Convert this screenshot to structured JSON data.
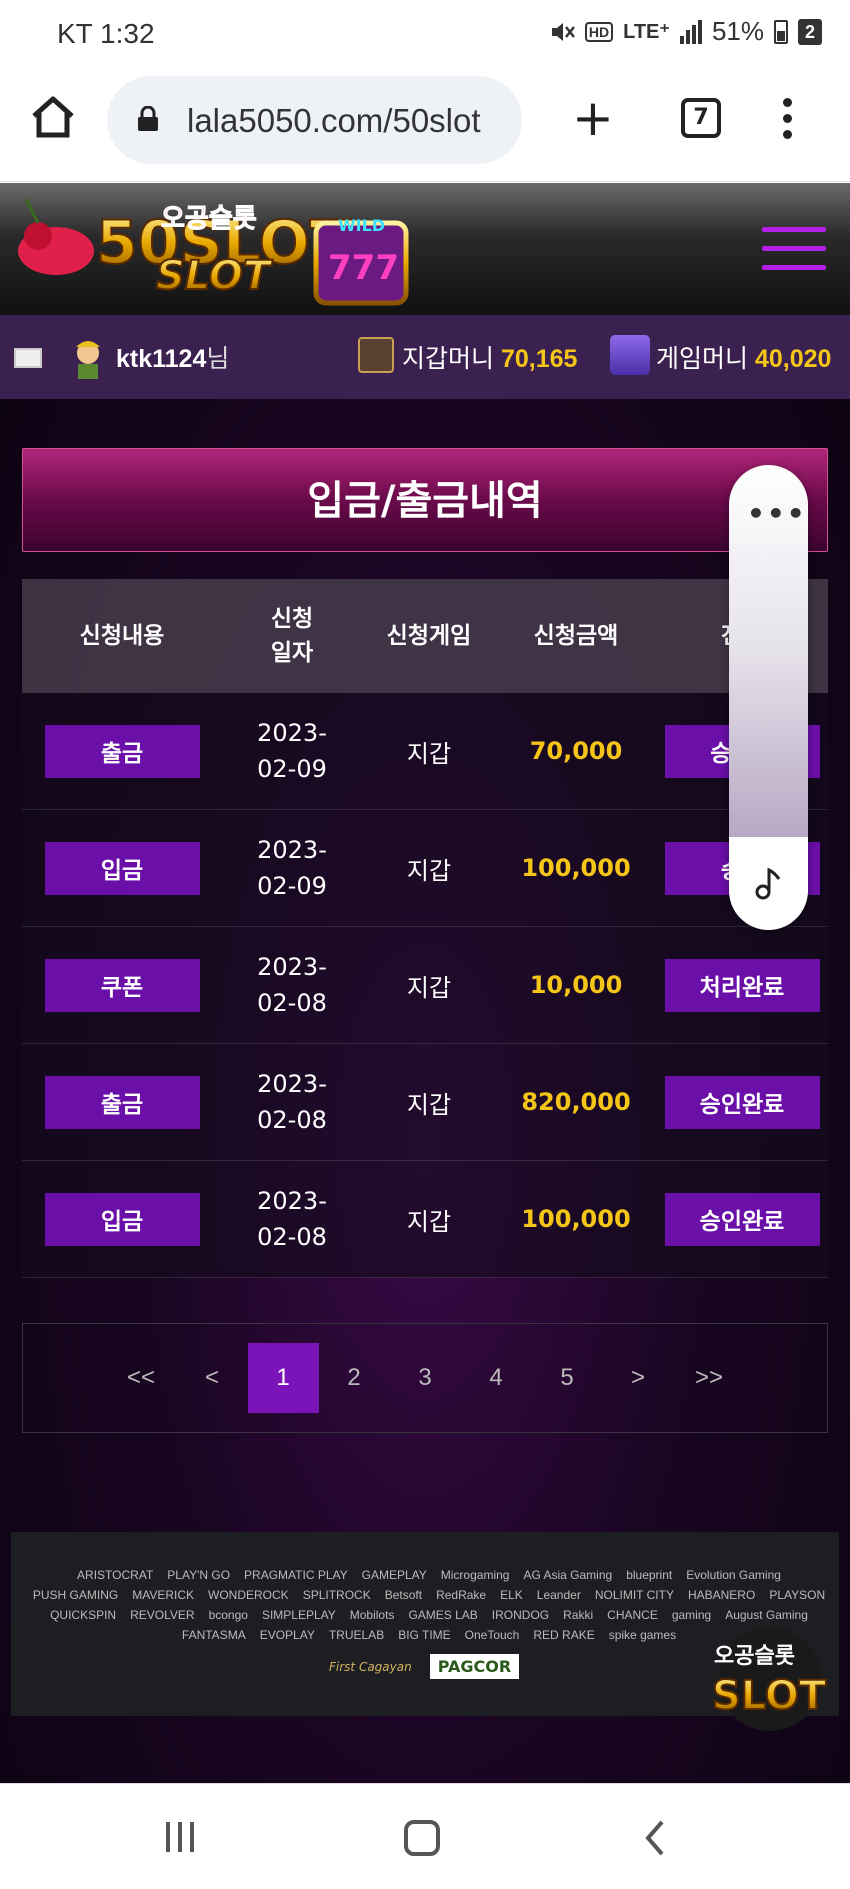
{
  "status": {
    "carrier_time": "KT 1:32",
    "network": "LTE⁺",
    "hd": "HD",
    "battery": "51%",
    "badge": "2"
  },
  "browser": {
    "url": "lala5050.com/50slot",
    "tab_count": "7"
  },
  "site": {
    "logo_text": "50SLOT",
    "logo_sub": "오공슬롯",
    "logo_badge": "WILD"
  },
  "user": {
    "name": "ktk1124",
    "suffix": "님",
    "wallet_label": "지갑머니",
    "wallet_value": "70,165",
    "game_label": "게임머니",
    "game_value": "40,020"
  },
  "page_title": "입금/출금내역",
  "table": {
    "headers": {
      "type": "신청내용",
      "date": "신청\n일자",
      "game": "신청게임",
      "amount": "신청금액",
      "status": "진행"
    },
    "rows": [
      {
        "type": "출금",
        "date": "2023-\n02-09",
        "game": "지갑",
        "amount": "70,000",
        "status": "승인요"
      },
      {
        "type": "입금",
        "date": "2023-\n02-09",
        "game": "지갑",
        "amount": "100,000",
        "status": "승인"
      },
      {
        "type": "쿠폰",
        "date": "2023-\n02-08",
        "game": "지갑",
        "amount": "10,000",
        "status": "처리완료"
      },
      {
        "type": "출금",
        "date": "2023-\n02-08",
        "game": "지갑",
        "amount": "820,000",
        "status": "승인완료"
      },
      {
        "type": "입금",
        "date": "2023-\n02-08",
        "game": "지갑",
        "amount": "100,000",
        "status": "승인완료"
      }
    ]
  },
  "pagination": {
    "first": "<<",
    "prev": "<",
    "pages": [
      "1",
      "2",
      "3",
      "4",
      "5"
    ],
    "next": ">",
    "last": ">>",
    "current": "1"
  },
  "footer": {
    "providers": [
      "ARISTOCRAT",
      "PLAY'N GO",
      "PRAGMATIC PLAY",
      "GAMEPLAY",
      "Microgaming",
      "AG Asia Gaming",
      "blueprint",
      "Evolution Gaming",
      "PUSH GAMING",
      "MAVERICK",
      "WONDEROCK",
      "SPLITROCK",
      "Betsoft",
      "RedRake",
      "ELK",
      "Leander",
      "NOLIMIT CITY",
      "HABANERO",
      "PLAYSON",
      "QUICKSPIN",
      "REVOLVER",
      "bcongo",
      "SIMPLEPLAY",
      "Mobilots",
      "GAMES LAB",
      "IRONDOG",
      "Rakki",
      "CHANCE",
      "gaming",
      "August Gaming",
      "FANTASMA",
      "EVOPLAY",
      "TRUELAB",
      "BIG TIME",
      "OneTouch",
      "RED RAKE",
      "spike games"
    ],
    "licenses": [
      "First Cagayan",
      "PAGCOR"
    ],
    "float_logo": "오공슬롯 SLOT"
  }
}
